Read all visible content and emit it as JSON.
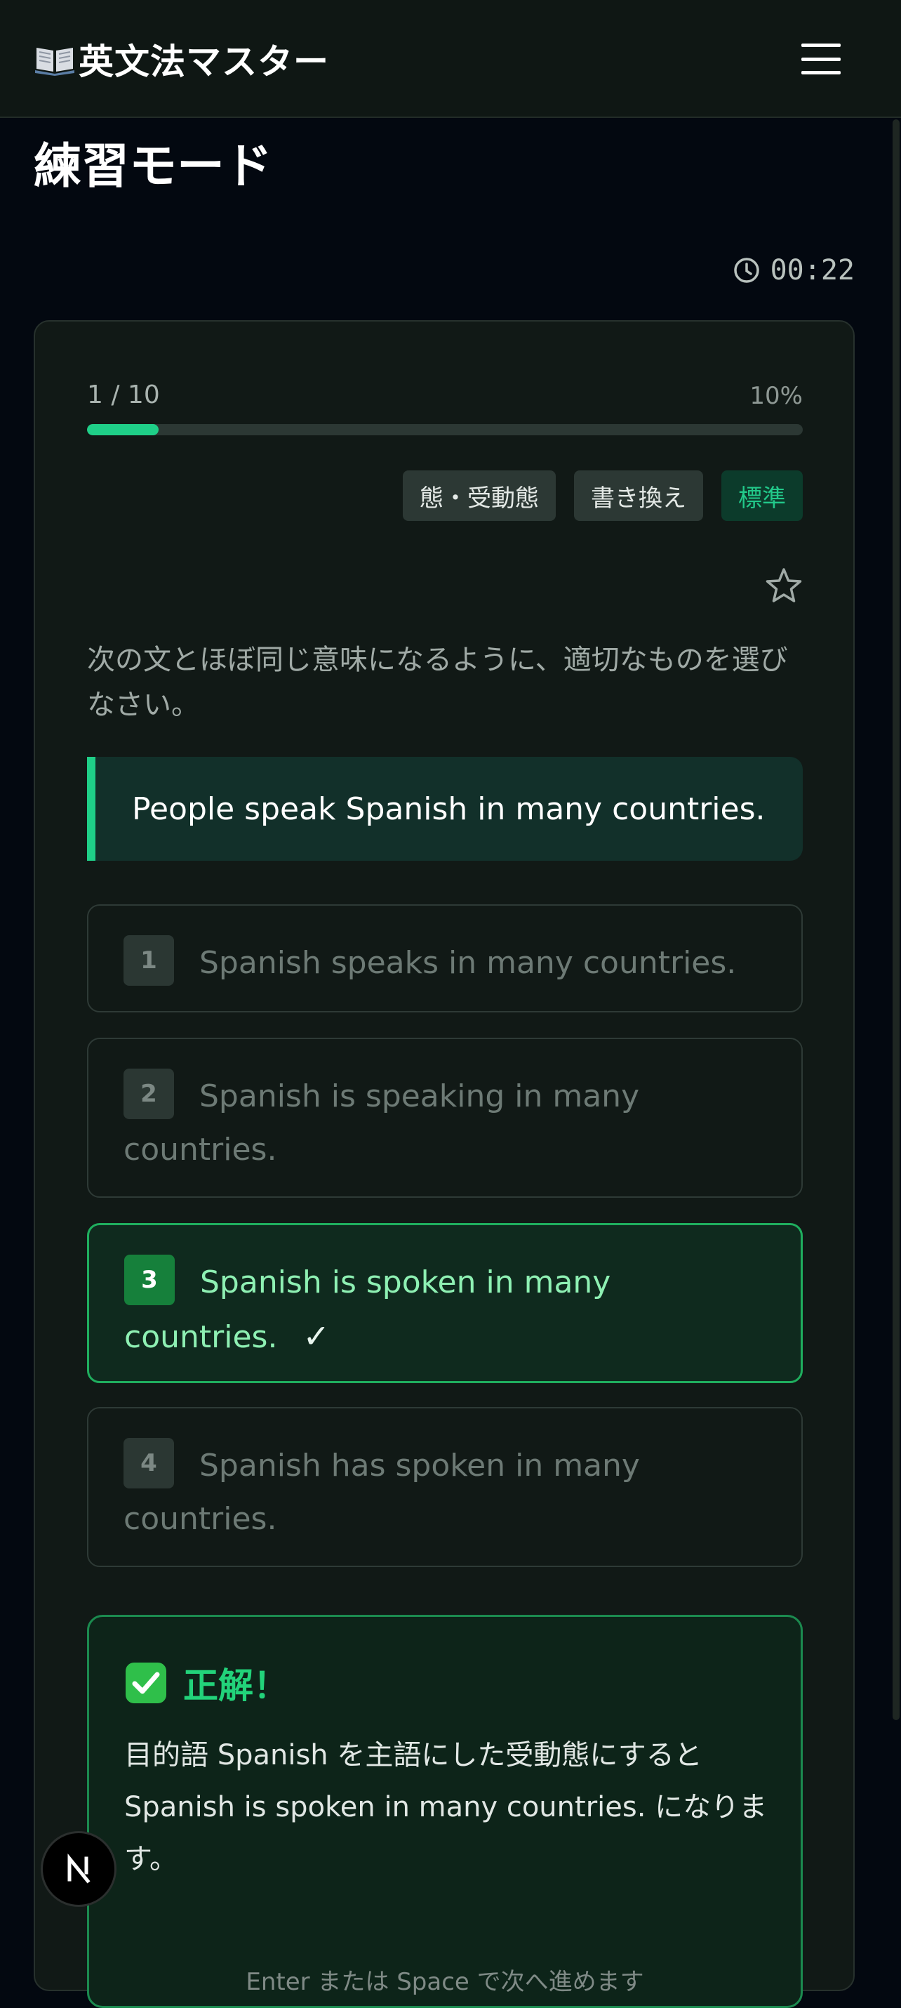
{
  "header": {
    "app_title": "英文法マスター",
    "book_icon": "open-book-icon",
    "menu_icon": "hamburger-menu-icon"
  },
  "page": {
    "title": "練習モード",
    "timer": "00:22"
  },
  "progress": {
    "label": "1 / 10",
    "percent_label": "10%",
    "fraction": 0.1
  },
  "tags": {
    "category": "態・受動態",
    "type": "書き換え",
    "level": "標準"
  },
  "question": {
    "instruction": "次の文とほぼ同じ意味になるように、適切なものを選びなさい。",
    "sentence": "People speak Spanish in many countries."
  },
  "choices": [
    {
      "num": "1",
      "text": "Spanish speaks in many countries."
    },
    {
      "num": "2",
      "text": "Spanish is speaking in many countries."
    },
    {
      "num": "3",
      "text": "Spanish is spoken in many countries.",
      "mark": "✓"
    },
    {
      "num": "4",
      "text": "Spanish has spoken in many countries."
    }
  ],
  "feedback": {
    "title": "正解！",
    "explanation": "目的語 Spanish を主語にした受動態にすると Spanish is spoken in many countries. になります。",
    "hint": "Enter または Space で次へ進めます"
  },
  "badge": {
    "letter": "N"
  },
  "colors": {
    "accent": "#1fcf88",
    "correct_border": "#1fae5e",
    "background": "#030810",
    "card": "#111916"
  }
}
